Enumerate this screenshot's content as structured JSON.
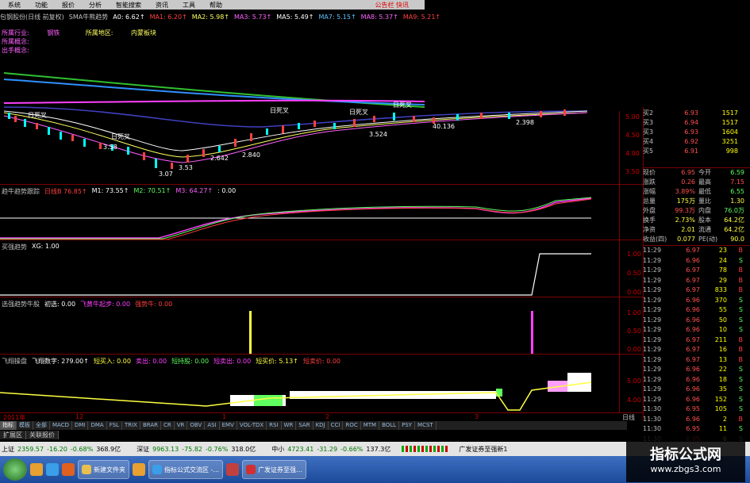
{
  "menu": {
    "items": [
      "系统",
      "功能",
      "报价",
      "分析",
      "智能搜索",
      "资讯",
      "工具",
      "帮助"
    ],
    "alert": "公告栏 快讯"
  },
  "header": {
    "stock": "包钢股份(日线 前复权)",
    "indicator": "SMA牛熊趋势",
    "a0": "A0: 6.62↑",
    "ma1": "MA1: 6.20↑",
    "ma2": "MA2: 5.98↑",
    "ma3": "MA3: 5.73↑",
    "ma5": "MA5: 5.49↑",
    "ma7": "MA7: 5.15↑",
    "ma8": "MA8: 5.37↑",
    "ma9": "MA9: 5.21↑"
  },
  "info": {
    "industry_label": "所属行业:",
    "industry": "钢铁",
    "region_label": "所属地区:",
    "region": "内蒙板块",
    "concept_label": "所属概念:",
    "outer_label": "出手概念:"
  },
  "main_chart": {
    "annotations": [
      "日死叉",
      "日死叉",
      "日死叉",
      "日死叉",
      "日死叉"
    ],
    "prices": [
      "2.642",
      "2.840",
      "3.524",
      "40.136",
      "2.398",
      "3.58",
      "3.53",
      "3.07"
    ],
    "yticks": [
      "5.00",
      "4.50",
      "4.00",
      "3.50"
    ]
  },
  "panel1": {
    "title": "趋牛趋势跟踪",
    "v0": "日线B 76.85↑",
    "m1": "M1: 73.55↑",
    "m2": "M2: 70.51↑",
    "m3": "M3: 64.27↑",
    "m4": ": 0.00"
  },
  "panel2": {
    "title": "买强趋势",
    "xg": "XG: 1.00",
    "yticks": [
      "1.00",
      "0.50",
      "0.00"
    ]
  },
  "panel3": {
    "title": "选强趋势牛股",
    "a": "初选: 0.00",
    "b": "飞黄牛起步: 0.00",
    "c": "强势牛: 0.00",
    "yticks": [
      "1.00",
      "0.50",
      "0.00"
    ]
  },
  "panel4": {
    "title": "飞翔操盘",
    "num": "飞翔数字: 279.00↑",
    "b1": "短买入: 0.00",
    "b2": "卖出: 0.00",
    "b3": "短持股: 0.00",
    "b4": "短卖出: 0.00",
    "b5": "短买价: 5.13↑",
    "b6": "短卖价: 0.00",
    "yticks": [
      "5.00",
      "4.00"
    ]
  },
  "xaxis": {
    "labels": [
      "2011年",
      "12",
      "1",
      "2",
      "3"
    ],
    "period": "日线"
  },
  "quote": {
    "rows": [
      {
        "l": "买2",
        "v": "6.93",
        "q": "1517"
      },
      {
        "l": "买3",
        "v": "6.94",
        "q": "1517"
      },
      {
        "l": "买3",
        "v": "6.93",
        "q": "1604"
      },
      {
        "l": "买4",
        "v": "6.92",
        "q": "3251"
      },
      {
        "l": "买5",
        "v": "6.91",
        "q": "998"
      }
    ],
    "stats": [
      {
        "a": "现价",
        "av": "6.95",
        "b": "今开",
        "bv": "6.59"
      },
      {
        "a": "涨跌",
        "av": "0.26",
        "b": "最高",
        "bv": "7.15"
      },
      {
        "a": "涨幅",
        "av": "3.89%",
        "b": "最低",
        "bv": "6.55"
      },
      {
        "a": "总量",
        "av": "175万",
        "b": "量比",
        "bv": "1.30"
      },
      {
        "a": "外盘",
        "av": "99.3万",
        "b": "内盘",
        "bv": "76.0万"
      },
      {
        "a": "换手",
        "av": "2.73%",
        "b": "股本",
        "bv": "64.2亿"
      },
      {
        "a": "净资",
        "av": "2.01",
        "b": "流通",
        "bv": "64.2亿"
      },
      {
        "a": "收益(四)",
        "av": "0.077",
        "b": "PE(动)",
        "bv": "90.0"
      }
    ],
    "ticks": [
      {
        "t": "11:29",
        "p": "6.97",
        "n": "23",
        "d": "B"
      },
      {
        "t": "11:29",
        "p": "6.96",
        "n": "24",
        "d": "S"
      },
      {
        "t": "11:29",
        "p": "6.97",
        "n": "78",
        "d": "B"
      },
      {
        "t": "11:29",
        "p": "6.97",
        "n": "29",
        "d": "B"
      },
      {
        "t": "11:29",
        "p": "6.97",
        "n": "833",
        "d": "B"
      },
      {
        "t": "11:29",
        "p": "6.96",
        "n": "370",
        "d": "S"
      },
      {
        "t": "11:29",
        "p": "6.96",
        "n": "55",
        "d": "S"
      },
      {
        "t": "11:29",
        "p": "6.96",
        "n": "50",
        "d": "S"
      },
      {
        "t": "11:29",
        "p": "6.96",
        "n": "10",
        "d": "S"
      },
      {
        "t": "11:29",
        "p": "6.97",
        "n": "211",
        "d": "B"
      },
      {
        "t": "11:29",
        "p": "6.97",
        "n": "16",
        "d": "B"
      },
      {
        "t": "11:29",
        "p": "6.97",
        "n": "13",
        "d": "B"
      },
      {
        "t": "11:29",
        "p": "6.96",
        "n": "22",
        "d": "S"
      },
      {
        "t": "11:29",
        "p": "6.96",
        "n": "18",
        "d": "S"
      },
      {
        "t": "11:29",
        "p": "6.96",
        "n": "35",
        "d": "S"
      },
      {
        "t": "11:29",
        "p": "6.96",
        "n": "152",
        "d": "S"
      },
      {
        "t": "11:30",
        "p": "6.95",
        "n": "105",
        "d": "S"
      },
      {
        "t": "11:30",
        "p": "6.96",
        "n": "2",
        "d": "B"
      },
      {
        "t": "11:30",
        "p": "6.95",
        "n": "11",
        "d": "S"
      },
      {
        "t": "11:30",
        "p": "6.95",
        "n": "6",
        "d": "S"
      }
    ]
  },
  "tabs": [
    "指标",
    "模板",
    "全部",
    "MACD",
    "DMI",
    "DMA",
    "FSL",
    "TRIX",
    "BRAR",
    "CR",
    "VR",
    "OBV",
    "ASI",
    "EMV",
    "VOL-TDX",
    "RSI",
    "WR",
    "SAR",
    "KDJ",
    "CCI",
    "ROC",
    "MTM",
    "BOLL",
    "PSY",
    "MCST"
  ],
  "tabs2": [
    "扩展区",
    "关联报价"
  ],
  "status": {
    "sh_label": "上证",
    "sh": "2359.57",
    "sh_chg": "-16.20",
    "sh_pct": "-0.68%",
    "sh_amt": "368.9亿",
    "sz_label": "深证",
    "sz": "9963.13",
    "sz_chg": "-75.82",
    "sz_pct": "-0.76%",
    "sz_amt": "318.0亿",
    "zx_label": "中小",
    "zx": "4723.41",
    "zx_chg": "-31.29",
    "zx_pct": "-0.66%",
    "zx_amt": "137.3亿",
    "broker": "广发证券至强新1"
  },
  "taskbar": {
    "items": [
      "新建文件夹",
      "指标公式交流区 -...",
      "广发证券至强..."
    ]
  },
  "watermark": {
    "title": "指标公式网",
    "url": "www.zbgs3.com"
  }
}
